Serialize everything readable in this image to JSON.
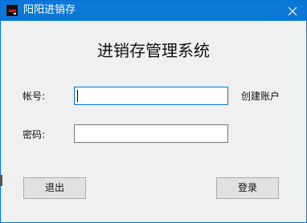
{
  "window": {
    "title": "阳阳进销存",
    "icons": {
      "app": "app-icon",
      "close": "close-icon"
    },
    "colors": {
      "titlebar": "#0b78d8",
      "client_bg": "#f0f0f0"
    }
  },
  "form": {
    "heading": "进销存管理系统",
    "account_label": "帐号:",
    "account_value": "",
    "password_label": "密码:",
    "password_value": "",
    "create_account_link": "创建账户",
    "exit_button": "退出",
    "login_button": "登录"
  }
}
